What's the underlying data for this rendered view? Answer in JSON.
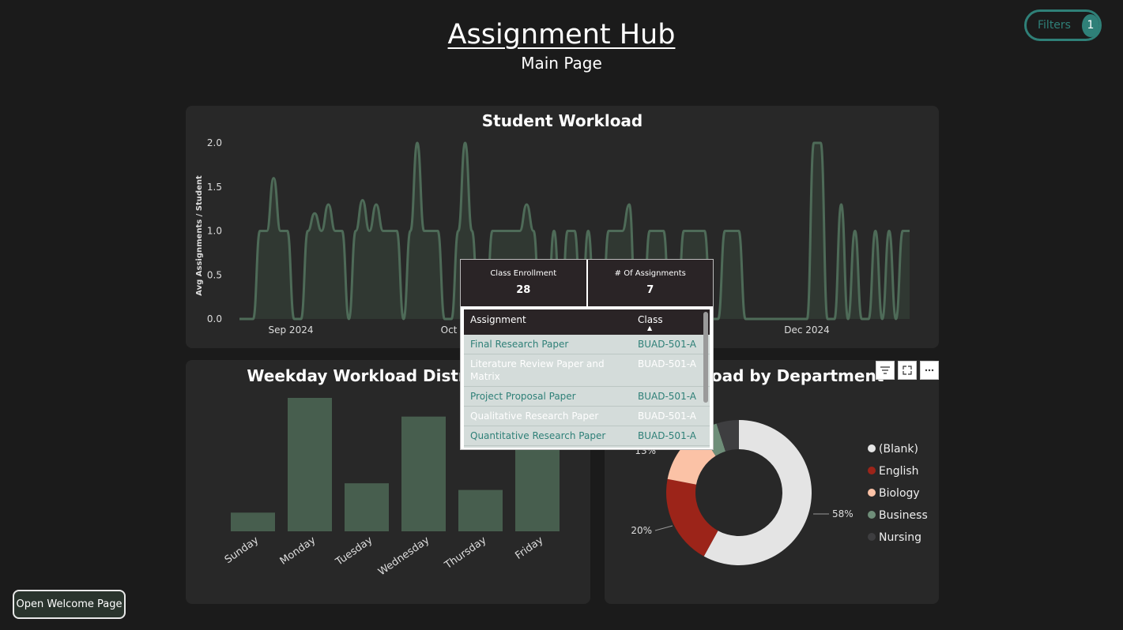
{
  "header": {
    "title": "Assignment Hub",
    "subtitle": "Main Page"
  },
  "filters": {
    "label": "Filters",
    "count": "1"
  },
  "workload_card": {
    "title": "Student Workload"
  },
  "weekday_card": {
    "title": "Weekday Workload Distribution"
  },
  "dept_card": {
    "title": "Workload by Department"
  },
  "welcome_button": {
    "label": "Open Welcome Page"
  },
  "tooltip": {
    "enrollment_label": "Class Enrollment",
    "enrollment_value": "28",
    "assignments_label": "# Of Assignments",
    "assignments_value": "7",
    "columns": [
      "Assignment",
      "Class"
    ],
    "rows": [
      {
        "assignment": "Final Research Paper",
        "class": "BUAD-501-A"
      },
      {
        "assignment": "Literature Review Paper and Matrix",
        "class": "BUAD-501-A"
      },
      {
        "assignment": "Project Proposal Paper",
        "class": "BUAD-501-A"
      },
      {
        "assignment": "Qualitative Research Paper",
        "class": "BUAD-501-A"
      },
      {
        "assignment": "Quantitative Research Paper",
        "class": "BUAD-501-A"
      }
    ]
  },
  "colors": {
    "line": "#4e6b58",
    "area": "#303832",
    "bar": "#475e4e",
    "accent": "#2f8078"
  },
  "chart_data": [
    {
      "type": "area",
      "ylabel": "Avg Assignments / Student",
      "ylim": [
        0,
        2.0
      ],
      "yticks": [
        "0.0",
        "0.5",
        "1.0",
        "1.5",
        "2.0"
      ],
      "xticks": [
        "Sep 2024",
        "Oct",
        "Dec 2024"
      ],
      "series": [
        {
          "values": [
            0,
            0,
            0,
            1,
            1,
            1.6,
            1,
            1,
            0,
            0,
            1,
            1.2,
            1,
            1.3,
            1,
            1,
            0,
            1,
            1.35,
            1,
            1.3,
            1,
            1,
            1,
            0,
            1,
            2,
            1,
            1,
            1,
            0,
            0,
            1,
            2,
            1,
            0,
            0,
            1,
            1,
            1,
            1,
            1,
            1.3,
            1,
            0,
            0,
            1,
            0,
            1,
            1,
            0,
            1,
            0,
            0,
            1,
            1,
            1,
            1.3,
            0,
            0,
            1,
            1,
            1,
            0,
            0,
            1,
            1,
            1,
            1,
            0,
            0,
            1,
            1,
            1,
            0,
            0,
            0,
            0,
            0,
            0,
            0,
            0,
            0,
            0,
            2,
            2,
            0,
            0,
            1.3,
            0,
            1,
            0,
            0,
            1,
            0,
            1,
            0,
            1,
            1
          ]
        }
      ]
    },
    {
      "type": "bar",
      "title": "Weekday Workload Distribution",
      "categories": [
        "Sunday",
        "Monday",
        "Tuesday",
        "Wednesday",
        "Thursday",
        "Friday"
      ],
      "values": [
        0.14,
        1.0,
        0.36,
        0.86,
        0.31,
        0.62
      ]
    },
    {
      "type": "pie",
      "title": "Workload by Department",
      "categories": [
        "(Blank)",
        "English",
        "Biology",
        "Business",
        "Nursing"
      ],
      "values": [
        58,
        20,
        13,
        4,
        5
      ],
      "data_labels": [
        "58%",
        "20%",
        "13%"
      ],
      "colors": [
        "#e4e4e4",
        "#9c2419",
        "#fbc2a6",
        "#6f8e79",
        "#3e3e40"
      ]
    }
  ]
}
